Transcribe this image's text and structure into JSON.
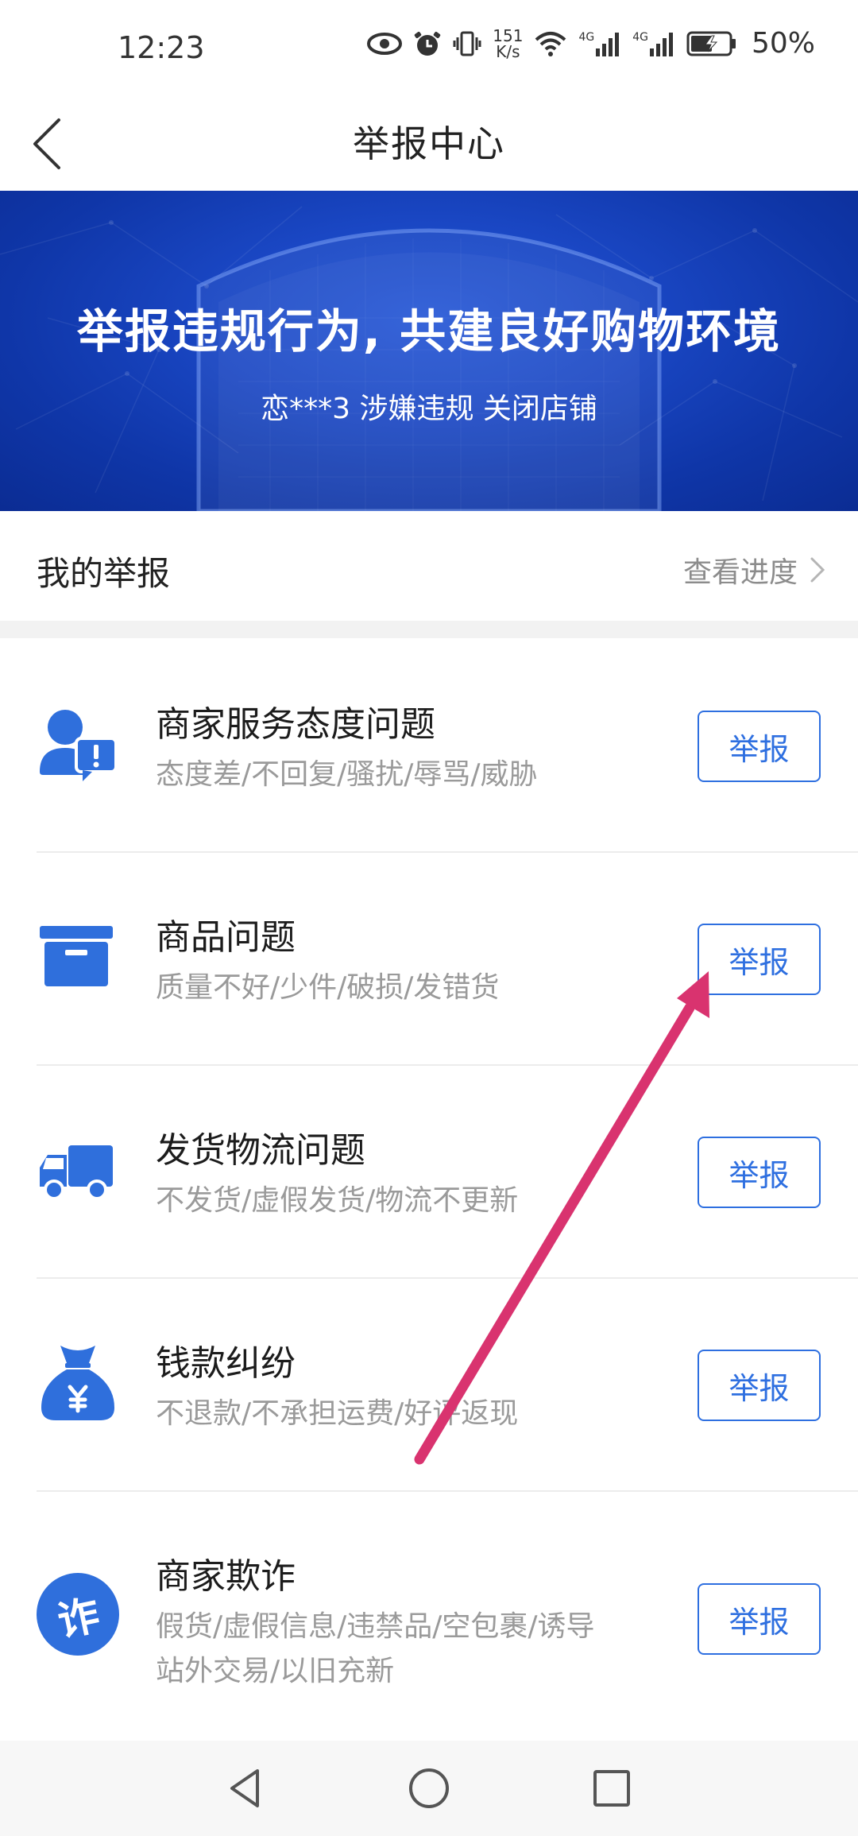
{
  "status_bar": {
    "time": "12:23",
    "net_speed_top": "151",
    "net_speed_bottom": "K/s",
    "net_type_1": "4G",
    "net_type_2": "4G",
    "battery": "50%",
    "icons": [
      "eye-icon",
      "alarm-icon",
      "vibrate-icon",
      "wifi-icon",
      "signal-icon",
      "signal-icon",
      "battery-charging-icon"
    ]
  },
  "header": {
    "title": "举报中心",
    "back_icon": "chevron-left-icon"
  },
  "banner": {
    "title": "举报违规行为, 共建良好购物环境",
    "subtitle": "恋***3 涉嫌违规 关闭店铺",
    "bg_color": "#1a47c4"
  },
  "my_reports": {
    "label": "我的举报",
    "link": "查看进度"
  },
  "categories": [
    {
      "title": "商家服务态度问题",
      "desc": "态度差/不回复/骚扰/辱骂/威胁",
      "button": "举报",
      "icon": "user-alert-icon"
    },
    {
      "title": "商品问题",
      "desc": "质量不好/少件/破损/发错货",
      "button": "举报",
      "icon": "box-icon"
    },
    {
      "title": "发货物流问题",
      "desc": "不发货/虚假发货/物流不更新",
      "button": "举报",
      "icon": "truck-icon"
    },
    {
      "title": "钱款纠纷",
      "desc": "不退款/不承担运费/好评返现",
      "button": "举报",
      "icon": "money-bag-icon"
    },
    {
      "title": "商家欺诈",
      "desc_lines": [
        "假货/虚假信息/违禁品/空包裹/诱导",
        "站外交易/以旧充新"
      ],
      "button": "举报",
      "icon": "fraud-icon",
      "icon_char": "诈"
    }
  ],
  "colors": {
    "accent": "#2e6fe0",
    "icon_blue": "#2f6fdc",
    "annotation_arrow": "#d9336f"
  },
  "nav_bar": {
    "icons": [
      "back-triangle-icon",
      "home-circle-icon",
      "recents-square-icon"
    ]
  }
}
